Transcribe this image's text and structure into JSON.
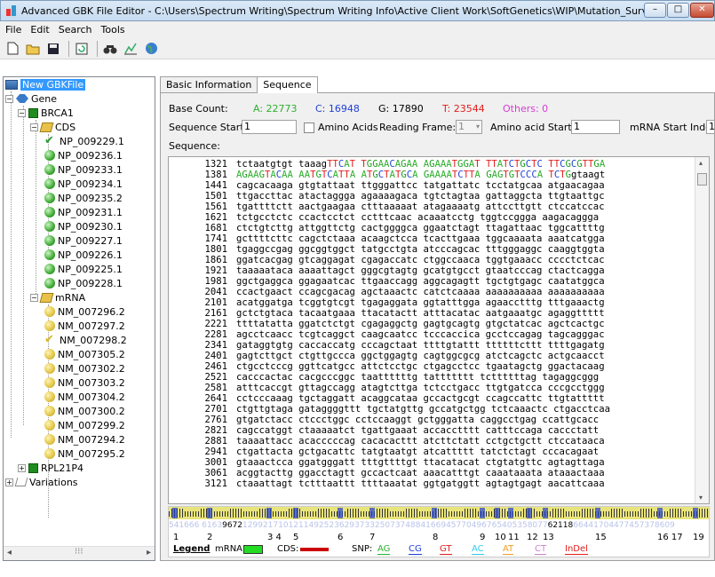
{
  "window": {
    "title": "Advanced GBK File Editor - C:\\Users\\Spectrum Writing\\Spectrum Writing Info\\Active Client Work\\SoftGenetics\\WIP\\Mutation_Surve...",
    "minimize": "–",
    "restore": "□",
    "close": "✕"
  },
  "menu": [
    "File",
    "Edit",
    "Search",
    "Tools"
  ],
  "toolbar": [
    "new-document-icon",
    "open-folder-icon",
    "save-icon",
    "refresh-icon",
    "find-icon",
    "chart-icon",
    "globe-icon"
  ],
  "tree": {
    "root": "New GBKFile",
    "gene": "Gene",
    "brca1": "BRCA1",
    "cds": "CDS",
    "cds_items": [
      "NP_009229.1",
      "NP_009236.1",
      "NP_009233.1",
      "NP_009234.1",
      "NP_009235.2",
      "NP_009231.1",
      "NP_009230.1",
      "NP_009227.1",
      "NP_009226.1",
      "NP_009225.1",
      "NP_009228.1"
    ],
    "mrna": "mRNA",
    "mrna_items": [
      "NM_007296.2",
      "NM_007297.2",
      "NM_007298.2",
      "NM_007305.2",
      "NM_007302.2",
      "NM_007303.2",
      "NM_007304.2",
      "NM_007300.2",
      "NM_007299.2",
      "NM_007294.2",
      "NM_007295.2"
    ],
    "rpl": "RPL21P4",
    "variations": "Variations"
  },
  "tabs": [
    "Basic Information",
    "Sequence"
  ],
  "stats": {
    "label": "Base Count:",
    "A": "A: 22773",
    "C": "C: 16948",
    "G": "G: 17890",
    "T": "T: 23544",
    "others": "Others:  0",
    "colors": {
      "A": "#2eaf2e",
      "C": "#1f3fd6",
      "G": "#000000",
      "T": "#e21d1d",
      "others": "#d43cd4"
    }
  },
  "controls": {
    "seq_start_label": "Sequence Start:",
    "seq_start_value": "1",
    "amino_acids": "Amino Acids",
    "reading_frame": "Reading Frame:",
    "reading_frame_value": "1",
    "aa_start_label": "Amino acid Start",
    "aa_start_value": "1",
    "mrna_start_label": "mRNA Start Index",
    "mrna_start_value": "1",
    "sequence_label": "Sequence:"
  },
  "sequence_lines": [
    [
      "1321",
      "tctaatgtgt taaagTTCAT TGGAACAGAA AGAAATGGAT TTATCTGCTC TTCGCGTTGA"
    ],
    [
      "1381",
      "AGAAGTACAA AATGTCATTA ATGCTATGCA GAAAATCTTA GAGTGTCCCA TCTGgtaagt"
    ],
    [
      "1441",
      "cagcacaaga gtgtattaat ttgggattcc tatgattatc tcctatgcaa atgaacagaa"
    ],
    [
      "1501",
      "ttgaccttac atactaggga agaaaagaca tgtctagtaa gattaggcta ttgtaattgc"
    ],
    [
      "1561",
      "tgattttctt aactgaagaa ctttaaaaat atagaaaatg attccttgtt ctccatccac"
    ],
    [
      "1621",
      "tctgcctctc ccactcctct cctttcaac acaaatcctg tggtccggga aagacaggga"
    ],
    [
      "1681",
      "ctctgtcttg attggttctg cactggggca ggaatctagt ttagattaac tggcattttg"
    ],
    [
      "1741",
      "gcttttcttc cagctctaaa acaagctcca tcacttgaaa tggcaaaata aaatcatgga"
    ],
    [
      "1801",
      "tgaggccgag ggcggtggct tatgcctgta atcccagcac tttgggaggc caaggtggta"
    ],
    [
      "1861",
      "ggatcacgag gtcaggagat cgagaccatc ctggccaaca tggtgaaacc cccctctcac"
    ],
    [
      "1921",
      "taaaaataca aaaattagct gggcgtagtg gcatgtgcct gtaatcccag ctactcagga"
    ],
    [
      "1981",
      "ggctgaggca ggagaatcac ttgaaccagg aggcagagtt tgctgtgagc caatatggca"
    ],
    [
      "2041",
      "ccactgaact ccagcgacag agctaaactc catctcaaaa aaaaaaaaaa aaaaaaaaaa"
    ],
    [
      "2101",
      "acatggatga tcggtgtcgt tgagaggata ggtatttgga agaacctttg tttgaaactg"
    ],
    [
      "2161",
      "gctctgtaca tacaatgaaa ttacatactt atttacatac aatgaaatgc agaggttttt"
    ],
    [
      "2221",
      "ttttatatta ggatctctgt cgagaggctg gagtgcagtg gtgctatcac agctcactgc"
    ],
    [
      "2281",
      "agcctcaacc tcgtcaggct caagcaatcc tcccaccica gcctccagag tagcagggac"
    ],
    [
      "2341",
      "gataggtgtg caccaccatg cccagctaat ttttgtattt ttttttcttt ttttgagatg"
    ],
    [
      "2401",
      "gagtcttgct ctgttgccca ggctggagtg cagtggcgcg atctcagctc actgcaacct"
    ],
    [
      "2461",
      "ctgcctcccg ggttcatgcc attctcctgc ctgagcctcc tgaatagctg ggactacaag"
    ],
    [
      "2521",
      "cacccactac cacgcccggc taattttttg tattttttt tcttttttag tagaggcggg"
    ],
    [
      "2581",
      "atttcaccgt gttagccagg atagtcttga tctcctgacc ttgtgatcca cccgcctggg"
    ],
    [
      "2641",
      "cctcccaaag tgctaggatt acaggcataa gccactgcgt ccagccattc ttgtattttt"
    ],
    [
      "2701",
      "ctgttgtaga gataggggttt tgctatgttg gccatgctgg tctcaaactc ctgacctcaa"
    ],
    [
      "2761",
      "gtgatctacc ctccctggc cctccaaggt gctgggatta caggcctgag ccattgcacc"
    ],
    [
      "2821",
      "cagccatggt ctaaaaatct tgattgaaat accacctttt catttccaga caccctatt"
    ],
    [
      "2881",
      "taaaattacc acacccccag cacacacttt atcttctatt cctgctgctt ctccataaca"
    ],
    [
      "2941",
      "ctgattacta gctgacattc tatgtaatgt atcattttt tatctctagt cccacagaat"
    ],
    [
      "3001",
      "gtaaactcca ggatgggatt tttgttttgt ttacatacat ctgtatgttc agtagttaga"
    ],
    [
      "3061",
      "acggtacttg ggacctagtt gccactcaat aaacatttgt caaataaata ataaactaaa"
    ],
    [
      "3121",
      "ctaaattagt tctttaattt ttttaaatat ggtgatggtt agtagtgagt aacattcaaa"
    ]
  ],
  "map": {
    "numbers_left": "541666  6163",
    "mark1": "9672",
    "numbers_mid": "129921710121149252362937332507374884166945770496765405358077",
    "mark2": "62118",
    "numbers_right": "66441704477457378609",
    "exons": [
      "1",
      "2",
      "3 4",
      "5",
      "6",
      "7",
      "8",
      "9",
      "10",
      "11",
      "12",
      "13",
      "15",
      "16 17",
      "19"
    ]
  },
  "legend": {
    "title": "Legend",
    "mrna": "mRNA:",
    "cds": "CDS:",
    "snp": "SNP:",
    "snp_items": [
      {
        "label": "AG",
        "color": "#2eaf2e"
      },
      {
        "label": "CG",
        "color": "#1f3fd6"
      },
      {
        "label": "GT",
        "color": "#e21d1d"
      },
      {
        "label": "AC",
        "color": "#33ccee"
      },
      {
        "label": "AT",
        "color": "#f0a020"
      },
      {
        "label": "CT",
        "color": "#d080d0"
      },
      {
        "label": "InDel",
        "color": "#e21d1d"
      }
    ],
    "mrna_color": "#22dd22",
    "cds_color": "#cc0000"
  }
}
